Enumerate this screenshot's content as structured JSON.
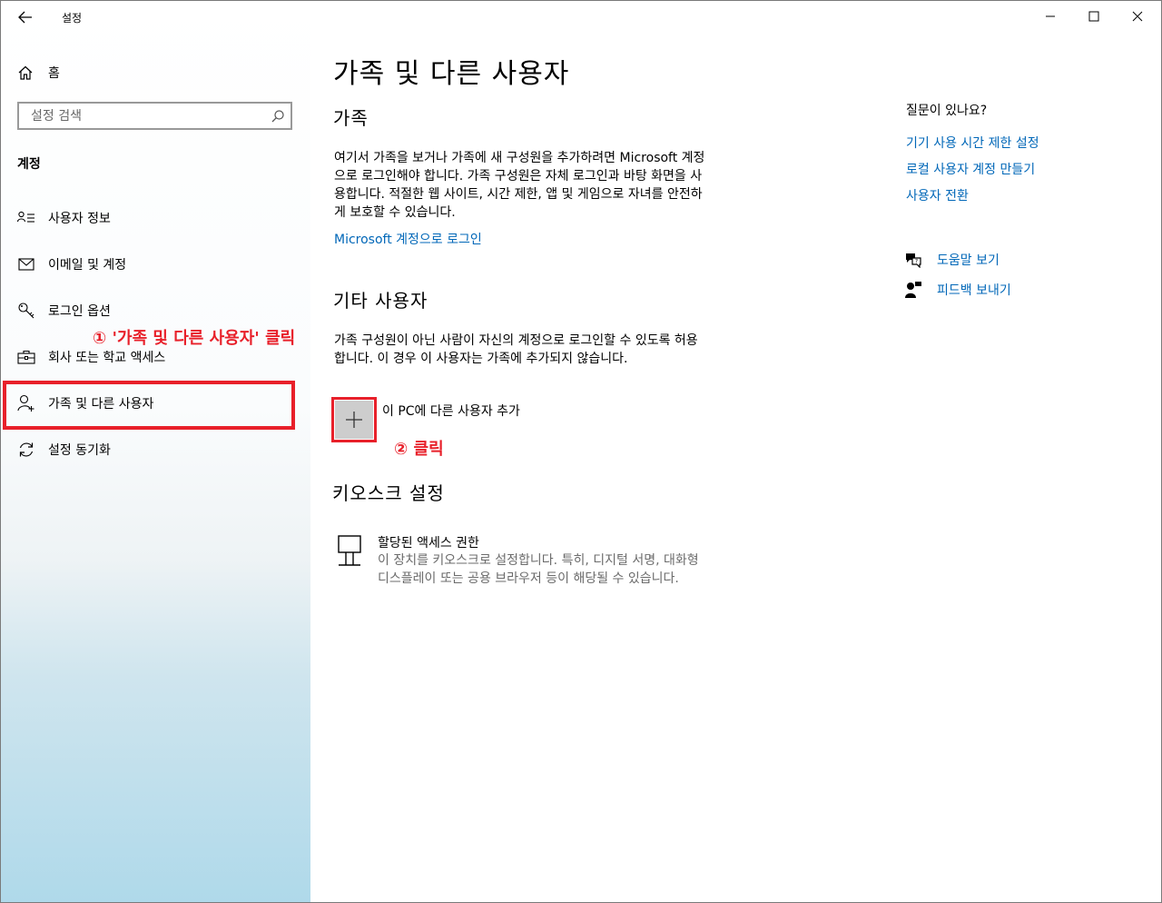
{
  "window": {
    "app_title": "설정"
  },
  "sidebar": {
    "home_label": "홈",
    "search_placeholder": "설정 검색",
    "section_title": "계정",
    "items": [
      {
        "label": "사용자 정보",
        "icon": "user-info-icon"
      },
      {
        "label": "이메일 및 계정",
        "icon": "mail-icon"
      },
      {
        "label": "로그인 옵션",
        "icon": "key-icon"
      },
      {
        "label": "회사 또는 학교 액세스",
        "icon": "briefcase-icon"
      },
      {
        "label": "가족 및 다른 사용자",
        "icon": "person-add-icon"
      },
      {
        "label": "설정 동기화",
        "icon": "sync-icon"
      }
    ]
  },
  "main": {
    "title": "가족 및 다른 사용자",
    "family": {
      "heading": "가족",
      "lines": [
        "여기서 가족을 보거나 가족에 새 구성원을 추가하려면 Microsoft 계정",
        "으로 로그인해야 합니다. 가족 구성원은 자체 로그인과 바탕 화면을 사",
        "용합니다. 적절한 웹 사이트, 시간 제한, 앱 및 게임으로 자녀를 안전하",
        "게 보호할 수 있습니다."
      ],
      "link": "Microsoft 계정으로 로그인"
    },
    "others": {
      "heading": "기타 사용자",
      "lines": [
        "가족 구성원이 아닌 사람이 자신의 계정으로 로그인할 수 있도록 허용",
        "합니다. 이 경우 이 사용자는 가족에 추가되지 않습니다."
      ],
      "add_label": "이 PC에 다른 사용자 추가"
    },
    "kiosk": {
      "heading": "키오스크 설정",
      "title": "할당된 액세스 권한",
      "lines": [
        "이 장치를 키오스크로 설정합니다. 특히, 디지털 서명, 대화형",
        "디스플레이 또는 공용 브라우저 등이 해당될 수 있습니다."
      ]
    }
  },
  "right_pane": {
    "heading": "질문이 있나요?",
    "links": [
      "기기 사용 시간 제한 설정",
      "로컬 사용자 계정 만들기",
      "사용자 전환"
    ],
    "help": "도움말 보기",
    "feedback": "피드백 보내기"
  },
  "annotations": {
    "step1": "① '가족 및 다른 사용자' 클릭",
    "step2": "② 클릭"
  },
  "colors": {
    "accent": "#0067b8",
    "annotation": "#e8202a"
  }
}
